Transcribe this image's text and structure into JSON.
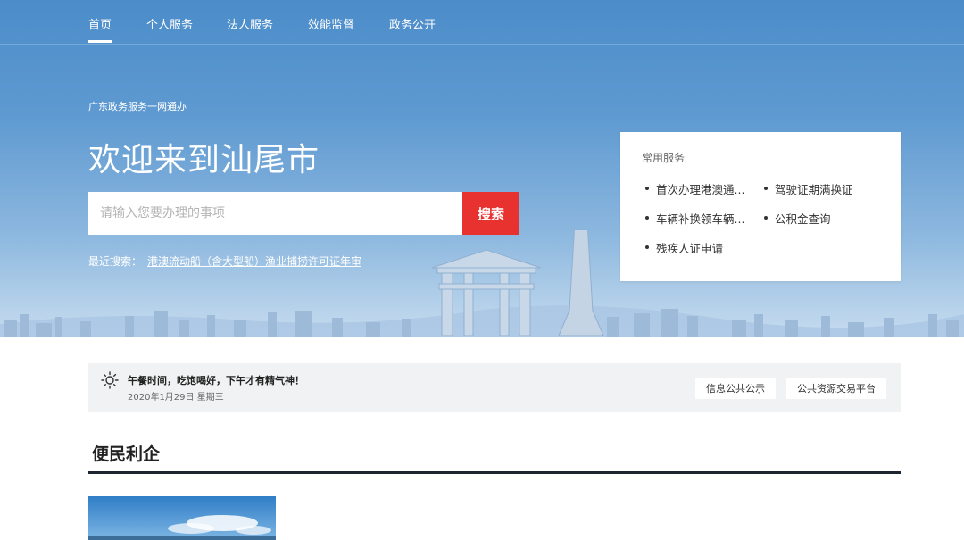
{
  "nav": {
    "items": [
      {
        "label": "首页",
        "active": true
      },
      {
        "label": "个人服务",
        "active": false
      },
      {
        "label": "法人服务",
        "active": false
      },
      {
        "label": "效能监督",
        "active": false
      },
      {
        "label": "政务公开",
        "active": false
      }
    ]
  },
  "hero": {
    "subtitle": "广东政务服务一网通办",
    "welcome": "欢迎来到汕尾市",
    "search": {
      "placeholder": "请输入您要办理的事项",
      "value": "",
      "button_label": "搜索"
    },
    "recent_label": "最近搜索：",
    "recent_item": "港澳流动船（含大型船）渔业捕捞许可证年审"
  },
  "services": {
    "title": "常用服务",
    "items": [
      "首次办理港澳通...",
      "驾驶证期满换证",
      "车辆补换领车辆...",
      "公积金查询",
      "残疾人证申请"
    ]
  },
  "notice": {
    "greeting": "午餐时间，吃饱喝好，下午才有精气神！",
    "date": "2020年1月29日 星期三",
    "buttons": [
      "信息公共公示",
      "公共资源交易平台"
    ]
  },
  "section": {
    "title": "便民利企"
  },
  "colors": {
    "hero_top": "#4b8cc9",
    "search_button": "#e8322f",
    "notice_bg": "#f1f2f3",
    "rule": "#1c2530"
  }
}
